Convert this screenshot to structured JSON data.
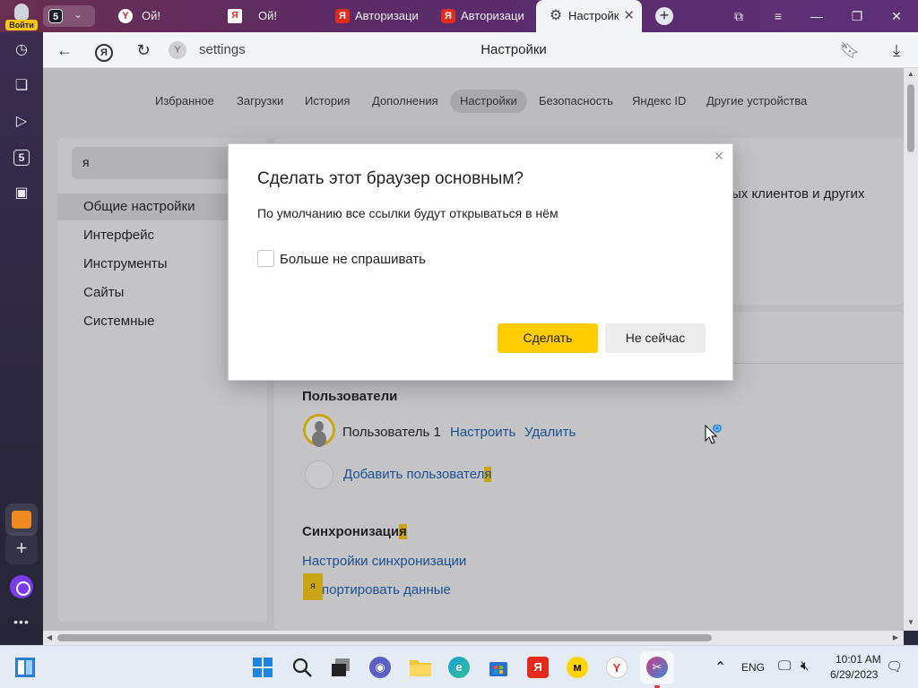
{
  "titlebar": {
    "profile_label": "Войти",
    "tab_counter": "5",
    "tabs": [
      {
        "label": "Ой!",
        "icon": "yandex-browser-icon"
      },
      {
        "label": "Ой!",
        "icon": "document-icon"
      },
      {
        "label": "Авторизаци",
        "icon": "yandex-icon"
      },
      {
        "label": "Авторизаци",
        "icon": "yandex-icon"
      },
      {
        "label": "Настройк",
        "icon": "gear-icon",
        "active": true
      }
    ]
  },
  "sidebar": {
    "items": [
      "history-icon",
      "collections-icon",
      "video-icon",
      "five-icon",
      "screenshot-icon"
    ],
    "mail": "mail-icon",
    "add": "+",
    "alice": "alice-icon",
    "more": "•••"
  },
  "addressbar": {
    "url": "settings",
    "page_title": "Настройки"
  },
  "settings": {
    "nav_tabs": [
      "Избранное",
      "Загрузки",
      "История",
      "Дополнения",
      "Настройки",
      "Безопасность",
      "Яндекс ID",
      "Другие устройства"
    ],
    "active_tab": "Настройки",
    "search_value": "я",
    "menu": [
      "Общие настройки",
      "Интерфейс",
      "Инструменты",
      "Сайты",
      "Системные"
    ],
    "partial_text": "ых клиентов и других",
    "users_title": "Пользователи",
    "user_name": "Пользователь 1",
    "configure_link": "Настроить",
    "delete_link": "Удалить",
    "add_user_prefix": "Добавить пользовател",
    "add_user_hl": "я",
    "sync_title_prefix": "Синхронизаци",
    "sync_title_hl": "я",
    "sync_settings_link": "Настройки синхронизации",
    "import_badge": "я",
    "import_link": "портировать данные"
  },
  "dialog": {
    "title": "Сделать этот браузер основным?",
    "description": "По умолчанию все ссылки будут открываться в нём",
    "checkbox_label": "Больше не спрашивать",
    "checkbox_checked": false,
    "primary_button": "Сделать",
    "secondary_button": "Не сейчас"
  },
  "taskbar": {
    "apps": [
      "windows-start-icon",
      "search-icon",
      "task-view-icon",
      "teams-icon",
      "file-explorer-icon",
      "edge-icon",
      "store-icon",
      "yandex-icon",
      "yandex-music-icon",
      "yandex-browser-icon",
      "snipping-tool-icon"
    ],
    "lang": "ENG",
    "time": "10:01 AM",
    "date": "6/29/2023"
  },
  "colors": {
    "accent_yellow": "#ffcc00",
    "link_blue": "#1d4f91",
    "highlight": "#c9a514"
  }
}
